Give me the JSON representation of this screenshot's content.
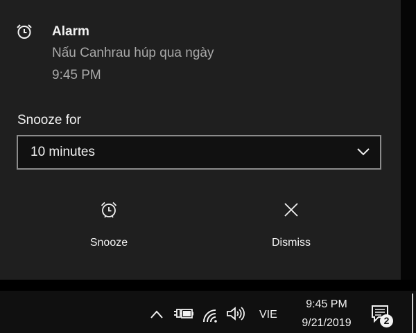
{
  "toast": {
    "app_icon": "alarm-clock-icon",
    "title": "Alarm",
    "message": "Nấu Canhrau húp qua ngày",
    "time": "9:45 PM",
    "snooze_label": "Snooze for",
    "snooze_selected": "10 minutes",
    "actions": [
      {
        "label": "Snooze",
        "icon": "alarm-clock-icon"
      },
      {
        "label": "Dismiss",
        "icon": "close-icon"
      }
    ]
  },
  "taskbar": {
    "icons": [
      "chevron-up-icon",
      "power-plug-battery-icon",
      "wifi-icon",
      "volume-icon"
    ],
    "language": "VIE",
    "clock_time": "9:45 PM",
    "clock_date": "9/21/2019",
    "notification_count": "2"
  },
  "colors": {
    "toast_background": "#1f1f1f",
    "taskbar_background": "#101010",
    "text_primary": "#f2f2f2",
    "text_secondary": "#a9a9a9"
  }
}
